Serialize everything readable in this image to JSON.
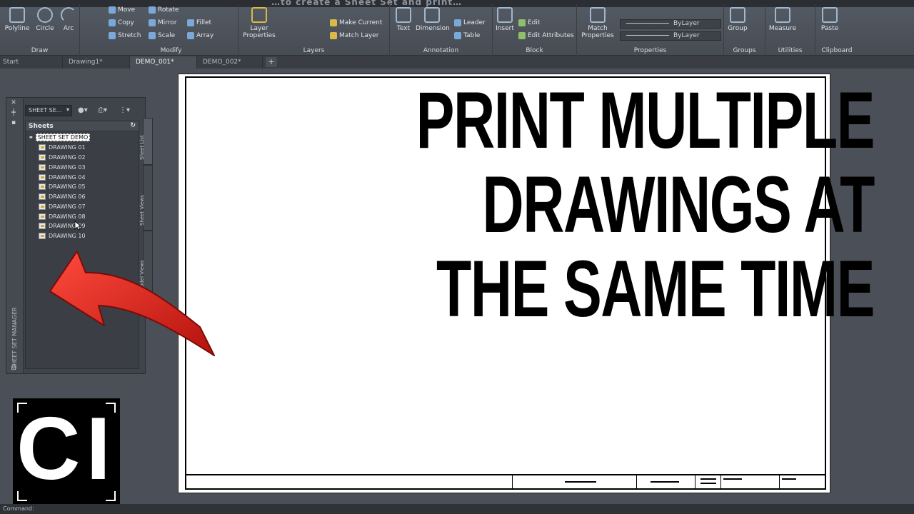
{
  "ribbon": {
    "title_overlay": "…to create a Sheet Set and print…",
    "draw": {
      "title": "Draw",
      "tools": [
        "Polyline",
        "Circle",
        "Arc"
      ]
    },
    "modify": {
      "title": "Modify",
      "tools": [
        "Move",
        "Rotate",
        "Copy",
        "Mirror",
        "Fillet",
        "Stretch",
        "Scale",
        "Array"
      ]
    },
    "layers": {
      "title": "Layers",
      "tools": [
        "Layer Properties",
        "Make Current",
        "Match Layer"
      ]
    },
    "annotation": {
      "title": "Annotation",
      "tools": [
        "Text",
        "Dimension",
        "Leader",
        "Table"
      ]
    },
    "block": {
      "title": "Block",
      "tools": [
        "Insert",
        "Edit",
        "Edit Attributes"
      ]
    },
    "properties": {
      "title": "Properties",
      "tools": [
        "Match Properties"
      ],
      "combo1": "ByLayer",
      "combo2": "ByLayer"
    },
    "groups": {
      "title": "Groups",
      "tools": [
        "Group"
      ]
    },
    "utilities": {
      "title": "Utilities",
      "tools": [
        "Measure"
      ]
    },
    "clipboard": {
      "title": "Clipboard",
      "tools": [
        "Paste"
      ]
    }
  },
  "tabs": [
    "Start",
    "Drawing1*",
    "DEMO_001*",
    "DEMO_002*"
  ],
  "palette": {
    "combo": "SHEET SE...",
    "vertical_title": "SHEET SET MANAGER",
    "sheets_header": "Sheets",
    "root": "SHEET SET DEMO",
    "sheets": [
      "DRAWING 01",
      "DRAWING 02",
      "DRAWING 03",
      "DRAWING 04",
      "DRAWING 05",
      "DRAWING 06",
      "DRAWING 07",
      "DRAWING 08",
      "DRAWING 09",
      "DRAWING 10"
    ],
    "side_tabs": [
      "Sheet List",
      "Sheet Views",
      "Model Views"
    ]
  },
  "headline": [
    "PRINT MULTIPLE",
    "DRAWINGS AT",
    "THE SAME TIME"
  ],
  "logo": "CI",
  "command": "Command:",
  "colors": {
    "arrow": "#e8231c",
    "sheet": "#ffffff",
    "ribbon": "#4f545c"
  }
}
